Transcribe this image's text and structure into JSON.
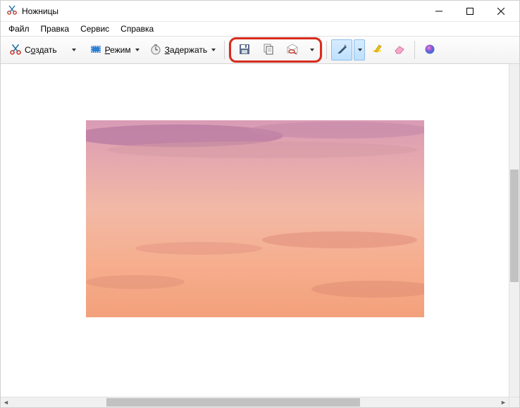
{
  "window": {
    "title": "Ножницы"
  },
  "menu": {
    "file": "Файл",
    "edit": "Правка",
    "tools": "Сервис",
    "help": "Справка"
  },
  "toolbar": {
    "new_prefix": "С",
    "new_underline": "о",
    "new_suffix": "здать",
    "mode_prefix": "",
    "mode_underline": "Р",
    "mode_suffix": "ежим",
    "delay_prefix": "",
    "delay_underline": "З",
    "delay_suffix": "адержать"
  }
}
